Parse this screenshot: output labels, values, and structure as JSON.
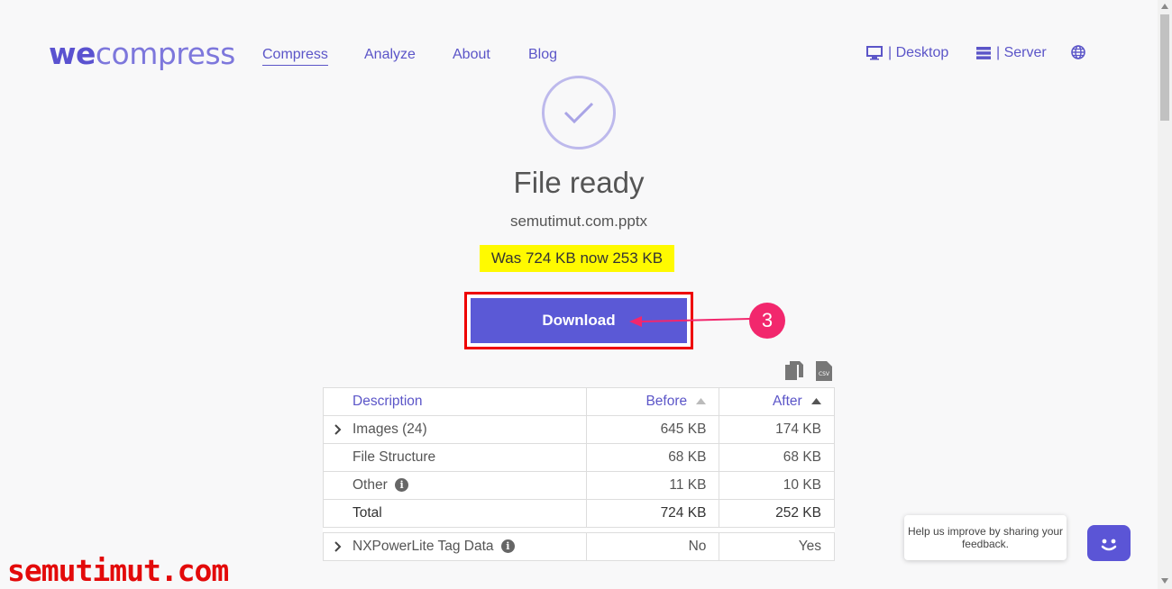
{
  "header": {
    "logo_bold": "we",
    "logo_light": "compress",
    "nav": [
      "Compress",
      "Analyze",
      "About",
      "Blog"
    ],
    "desktop_label": "| Desktop",
    "server_label": "| Server"
  },
  "main": {
    "title": "File ready",
    "filename": "semutimut.com.pptx",
    "size_note": "Was 724 KB now 253 KB",
    "download_label": "Download",
    "callout_number": "3"
  },
  "table": {
    "headers": {
      "description": "Description",
      "before": "Before",
      "after": "After"
    },
    "rows": [
      {
        "description": "Images (24)",
        "before": "645 KB",
        "after": "174 KB"
      },
      {
        "description": "File Structure",
        "before": "68 KB",
        "after": "68 KB"
      },
      {
        "description": "Other",
        "before": "11 KB",
        "after": "10 KB"
      },
      {
        "description": "Total",
        "before": "724 KB",
        "after": "252 KB"
      },
      {
        "description": "NXPowerLite Tag Data",
        "before": "No",
        "after": "Yes"
      }
    ],
    "info_glyph": "i"
  },
  "feedback": {
    "text": "Help us improve by sharing your feedback."
  },
  "watermark": "semutimut.com",
  "colors": {
    "accent": "#5b59d6",
    "highlight": "#fffa00",
    "callout": "#f2276d",
    "frame": "#e00000"
  }
}
